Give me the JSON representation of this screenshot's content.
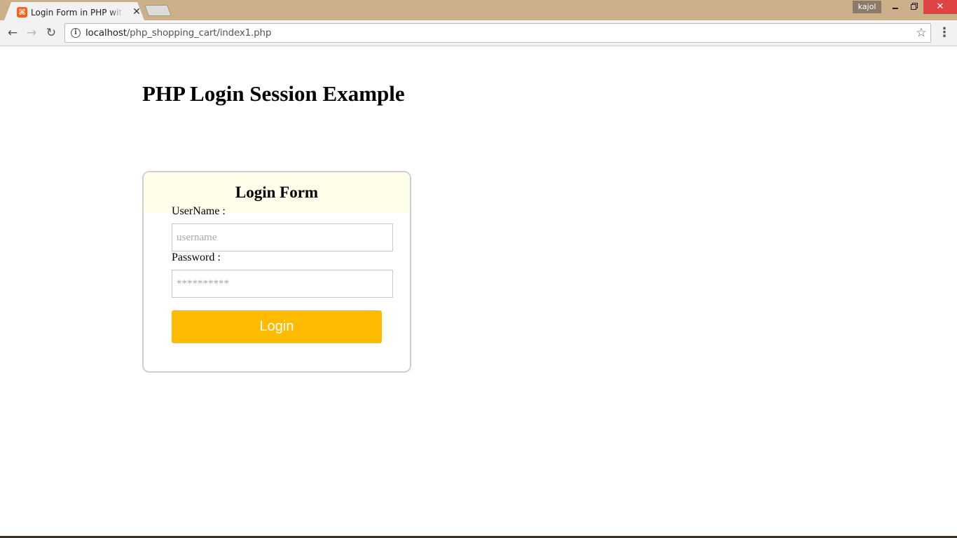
{
  "browser": {
    "tab_title": "Login Form in PHP with Session",
    "tab_favicon_glyph": "⌘",
    "tab_close_glyph": "✕",
    "profile_name": "kajol",
    "window_close_glyph": "✕",
    "url_host": "localhost",
    "url_path": "/php_shopping_cart/index1.php",
    "back_glyph": "←",
    "forward_glyph": "→",
    "reload_glyph": "↻",
    "info_glyph": "i",
    "star_glyph": "☆",
    "menu_glyph": "⋮",
    "icons": {
      "favicon": "xampp-icon",
      "back": "back-arrow-icon",
      "forward": "forward-arrow-icon",
      "reload": "reload-icon",
      "info": "info-icon",
      "star": "bookmark-star-icon",
      "menu": "kebab-menu-icon"
    },
    "colors": {
      "frame": "#cbb08a",
      "close_button": "#e04343",
      "favicon": "#f1631f"
    }
  },
  "page": {
    "title": "PHP Login Session Example",
    "form": {
      "title": "Login Form",
      "username_label": "UserName :",
      "username_placeholder": "username",
      "username_value": "",
      "password_label": "Password :",
      "password_placeholder": "**********",
      "password_value": "",
      "submit_label": "Login"
    },
    "colors": {
      "button": "#ffbb00",
      "card_header": "#fefeea",
      "card_border": "#cfcfcf"
    }
  }
}
